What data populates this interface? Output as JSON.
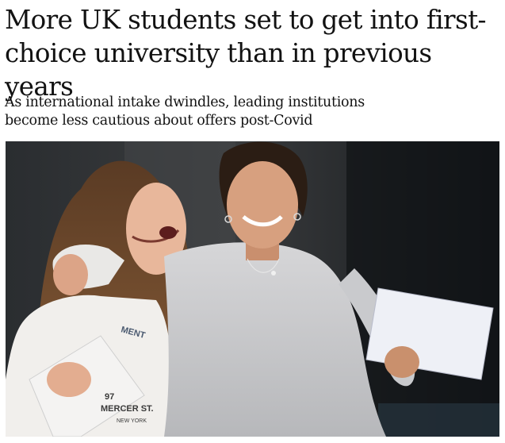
{
  "article": {
    "headline_line1": "More UK students set to get into first-",
    "headline_line2": "choice university than in previous years",
    "standfirst_line1": "As international intake dwindles, leading institutions",
    "standfirst_line2": "become less cautious about offers post-Covid"
  },
  "photo": {
    "shirt_print_line1": "MENT",
    "shirt_print_line2": "97",
    "shirt_print_line3": "MERCER ST.",
    "shirt_print_line4": "NEW YORK"
  }
}
